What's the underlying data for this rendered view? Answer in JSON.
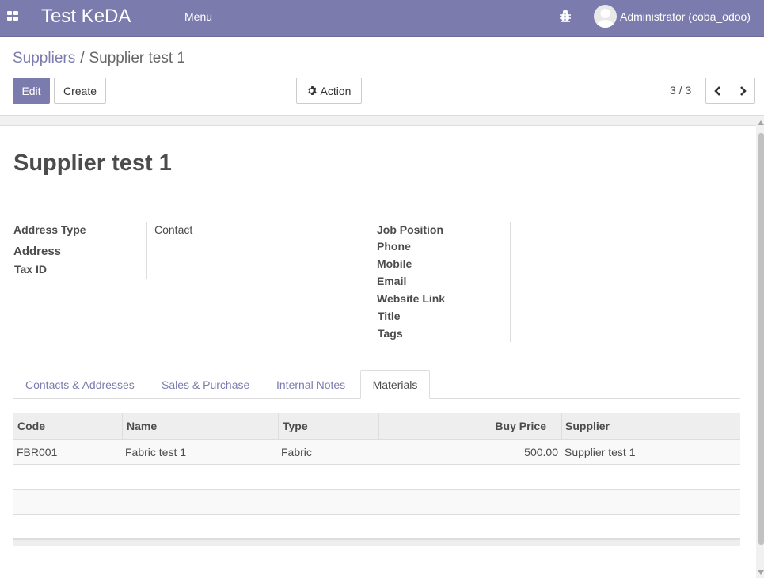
{
  "navbar": {
    "brand": "Test KeDA",
    "menu_label": "Menu",
    "user_name": "Administrator (coba_odoo)",
    "bg_color": "#7c7bad"
  },
  "breadcrumb": {
    "parent": "Suppliers",
    "separator": "/",
    "current": "Supplier test 1"
  },
  "buttons": {
    "edit": "Edit",
    "create": "Create",
    "action": "Action"
  },
  "pager": {
    "value": "3 / 3"
  },
  "record": {
    "title": "Supplier test 1",
    "left_fields": [
      {
        "label": "Address Type",
        "value": "Contact"
      },
      {
        "label": "Address",
        "value": ""
      },
      {
        "label": "Tax ID",
        "value": ""
      }
    ],
    "right_fields": [
      {
        "label": "Job Position",
        "value": ""
      },
      {
        "label": "Phone",
        "value": ""
      },
      {
        "label": "Mobile",
        "value": ""
      },
      {
        "label": "Email",
        "value": ""
      },
      {
        "label": "Website Link",
        "value": ""
      },
      {
        "label": "Title",
        "value": ""
      },
      {
        "label": "Tags",
        "value": ""
      }
    ]
  },
  "tabs": [
    {
      "label": "Contacts & Addresses",
      "active": false
    },
    {
      "label": "Sales & Purchase",
      "active": false
    },
    {
      "label": "Internal Notes",
      "active": false
    },
    {
      "label": "Materials",
      "active": true
    }
  ],
  "materials_table": {
    "columns": [
      "Code",
      "Name",
      "Type",
      "Buy Price",
      "Supplier"
    ],
    "rows": [
      {
        "code": "FBR001",
        "name": "Fabric test 1",
        "type": "Fabric",
        "buy_price": "500.00",
        "supplier": "Supplier test 1"
      }
    ]
  },
  "icons": {
    "apps": "apps-grid-icon",
    "bug": "bug-icon",
    "avatar": "user-avatar-icon",
    "gear": "gear-icon",
    "prev": "chevron-left-icon",
    "next": "chevron-right-icon"
  }
}
